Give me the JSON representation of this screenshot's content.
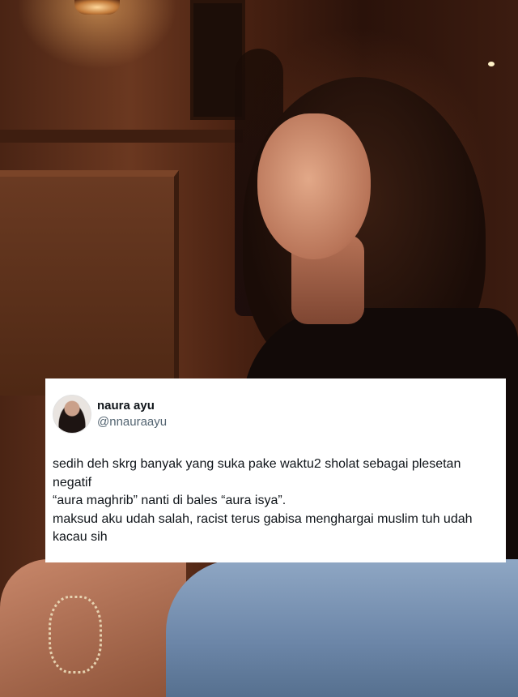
{
  "tweet": {
    "display_name": "naura ayu",
    "handle": "@nnauraayu",
    "lines": [
      "sedih deh skrg banyak yang suka pake waktu2 sholat sebagai plesetan negatif",
      "“aura maghrib” nanti di bales “aura isya”.",
      "maksud aku udah salah, racist terus gabisa menghargai muslim tuh udah kacau sih"
    ]
  },
  "colors": {
    "card_background": "#ffffff",
    "name_text": "#0f1419",
    "handle_text": "#536471"
  }
}
